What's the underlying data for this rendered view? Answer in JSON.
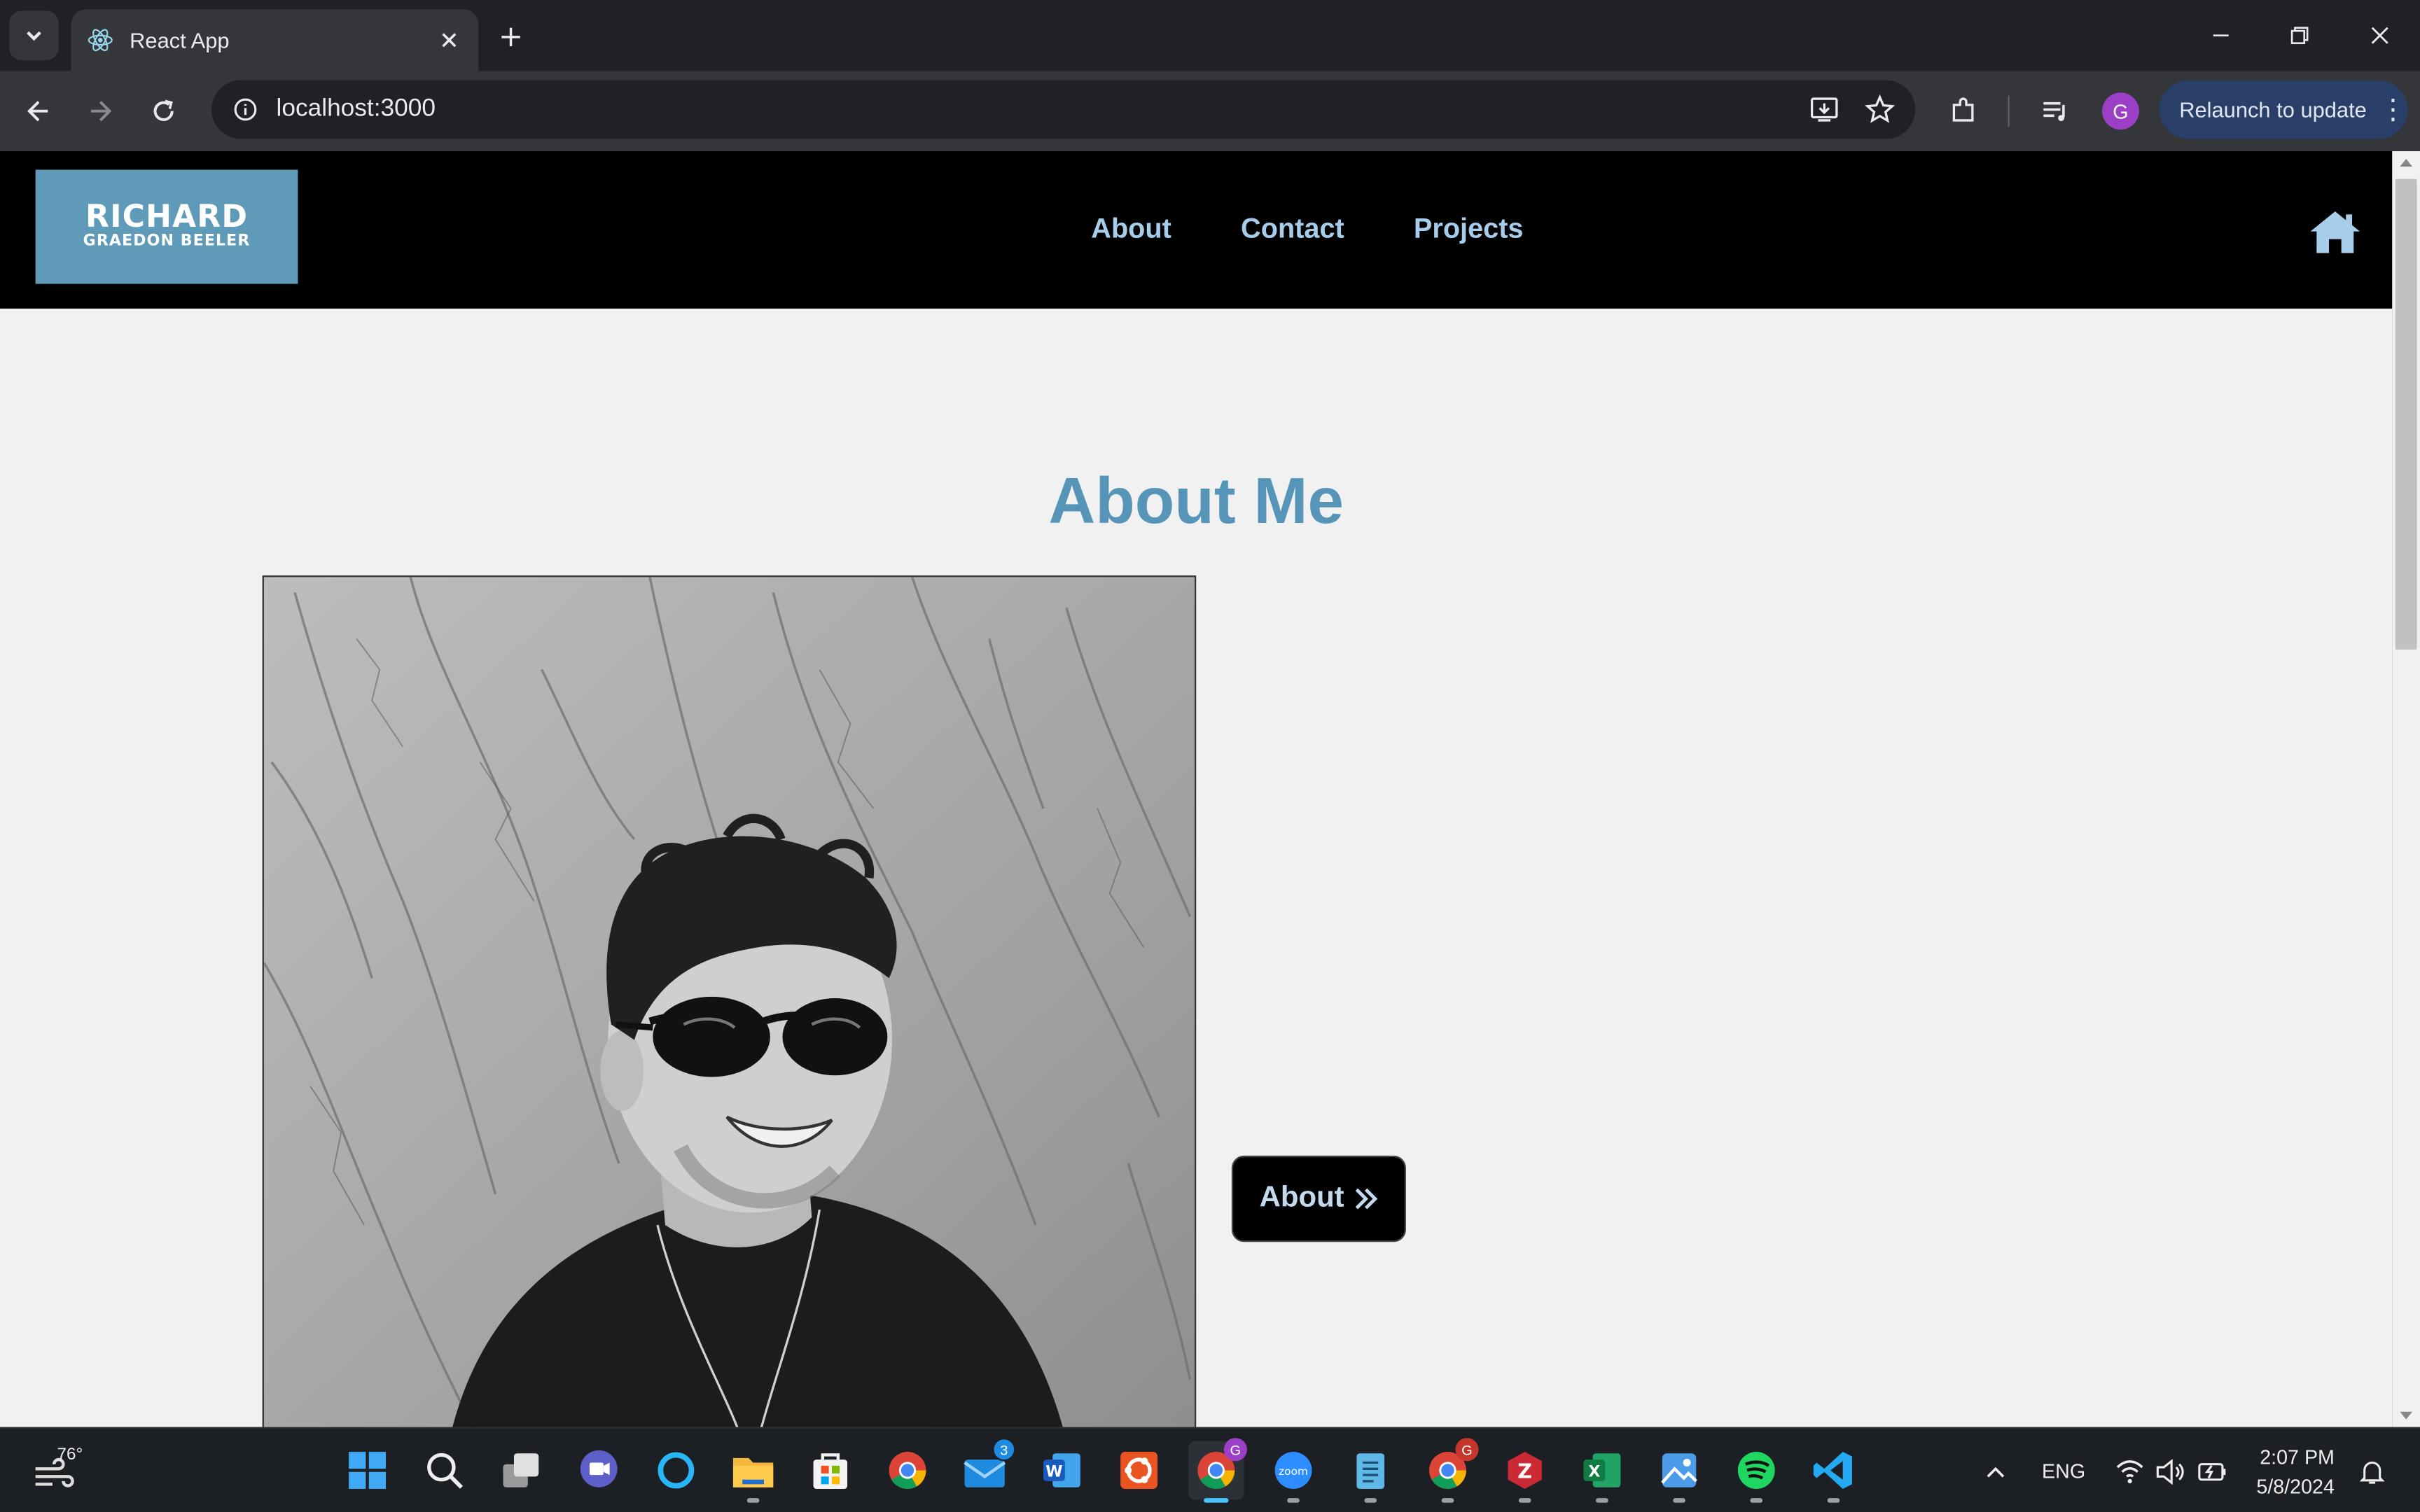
{
  "browser": {
    "tab_title": "React App",
    "url": "localhost:3000",
    "profile_initial": "G",
    "relaunch_label": "Relaunch to update"
  },
  "site": {
    "logo_line1": "RICHARD",
    "logo_line2": "GRAEDON BEELER",
    "nav": [
      "About",
      "Contact",
      "Projects"
    ],
    "heading": "About Me",
    "about_button": "About",
    "colors": {
      "accent": "#5795b8",
      "nav_link": "#a7cdea",
      "nav_bg": "#000000",
      "page_bg": "#f1f1f1",
      "logo_bg": "#5f9ab8"
    }
  },
  "taskbar": {
    "weather_temp": "76°",
    "language": "ENG",
    "time": "2:07 PM",
    "date": "5/8/2024",
    "mail_badge": "3",
    "chrome_profile_badge": "G",
    "chrome2_badge": "G"
  }
}
